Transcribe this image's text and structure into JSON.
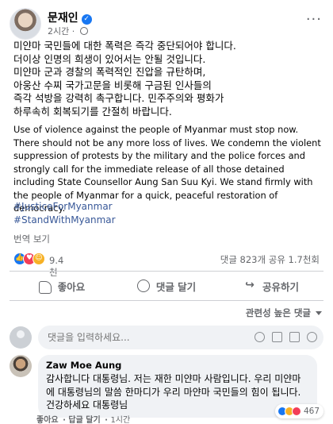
{
  "post": {
    "author": "문재인",
    "time": "2시간",
    "korean_lines": [
      "미얀마 국민들에 대한 폭력은 즉각 중단되어야 합니다.",
      "더이상 인명의 희생이 있어서는 안될 것입니다.",
      "미얀마 군과 경찰의 폭력적인 진압을 규탄하며,",
      "아웅산 수찌 국가고문을 비롯해 구금된 인사들의",
      "즉각 석방을 강력히 촉구합니다. 민주주의와 평화가",
      "하루속히 회복되기를 간절히 바랍니다."
    ],
    "english": "Use of violence against the people of Myanmar must stop now. There should not be any more loss of lives. We condemn the violent suppression of protests by the military and the police forces and strongly call for the immediate release of all those detained including State Counsellor Aung San Suu Kyi. We stand firmly with the people of Myanmar for a quick, peaceful restoration of democracy.",
    "hashtags": [
      "#JusticeForMyanmar",
      "#StandWithMyanmar"
    ],
    "translate_label": "번역 보기"
  },
  "stats": {
    "reaction_count": "9.4천",
    "counts": "댓글 823개  공유 1.7천회"
  },
  "actions": {
    "like": "좋아요",
    "comment": "댓글 달기",
    "share": "공유하기"
  },
  "sort_label": "관련성 높은 댓글",
  "composer": {
    "placeholder": "댓글을 입력하세요..."
  },
  "comment": {
    "author": "Zaw Moe Aung",
    "text": "감사합니다 대통령님. 저는 재한 미얀마 사람입니다. 우리 미얀마에 대통령님의 말씀 한마디가 우리 마얀마 국민들의 힘이 됩니다. 건강하세요 대통령님",
    "reaction_count": "467",
    "like_label": "좋아요",
    "reply_label": "답글 달기",
    "time": "1시간"
  },
  "colors": {
    "accent": "#1877f2",
    "hashtag": "#385898",
    "muted": "#65676b"
  }
}
